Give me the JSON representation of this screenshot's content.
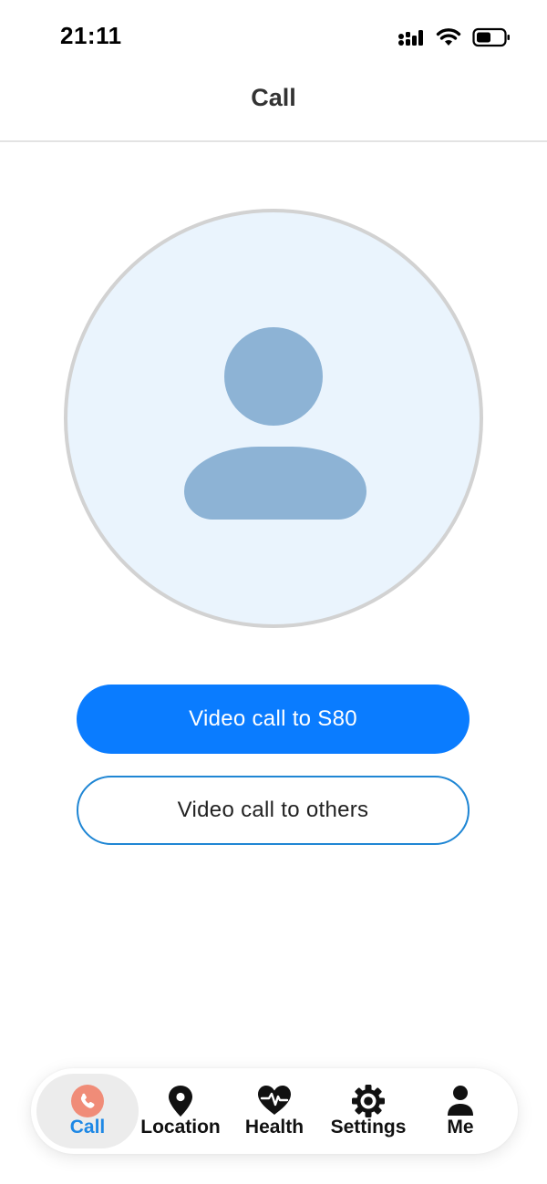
{
  "status_bar": {
    "time": "21:11",
    "icons": [
      "signal-icon",
      "wifi-icon",
      "battery-icon"
    ]
  },
  "header": {
    "title": "Call"
  },
  "avatar": {
    "icon": "person-icon",
    "background_color": "#eaf4fd",
    "figure_color": "#8db3d5"
  },
  "actions": {
    "primary_label": "Video call to S80",
    "secondary_label": "Video call to others",
    "accent_color": "#0a7cff"
  },
  "bottom_nav": {
    "items": [
      {
        "label": "Call",
        "icon": "phone-icon",
        "active": true
      },
      {
        "label": "Location",
        "icon": "location-pin-icon",
        "active": false
      },
      {
        "label": "Health",
        "icon": "heart-pulse-icon",
        "active": false
      },
      {
        "label": "Settings",
        "icon": "gear-icon",
        "active": false
      },
      {
        "label": "Me",
        "icon": "user-icon",
        "active": false
      }
    ],
    "active_color": "#1e88e5"
  }
}
